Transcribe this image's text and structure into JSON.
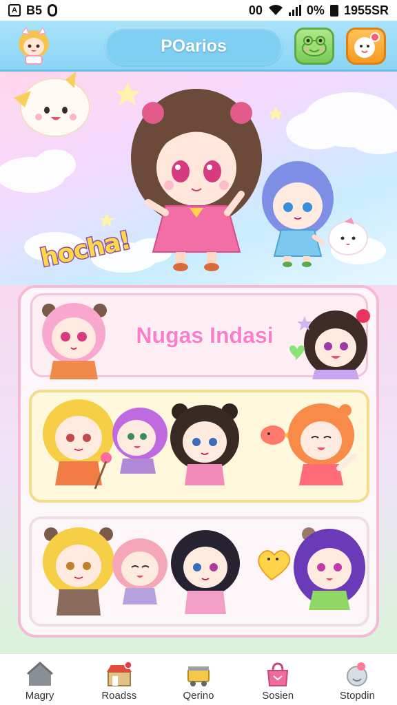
{
  "status_bar": {
    "left_badge": "A",
    "left_text": "B5",
    "right_text": "00",
    "battery_pct": "0%",
    "clock": "1955SR"
  },
  "header": {
    "title": "POarios",
    "left_icon": "character-avatar-icon",
    "green_button_icon": "frog-face-icon",
    "orange_button_icon": "chat-face-icon",
    "colors": {
      "header_bg": "#8bd5f5",
      "pill": "#7fcff3",
      "green": "#79c95a",
      "orange": "#f79a22"
    }
  },
  "hero": {
    "speech_text": "hocha!"
  },
  "cards": {
    "first_title": "Nugas Indasi"
  },
  "bottom_nav": {
    "items": [
      {
        "label": "Magry",
        "icon": "home-icon"
      },
      {
        "label": "Roadss",
        "icon": "shop-icon"
      },
      {
        "label": "Qerino",
        "icon": "gift-box-icon"
      },
      {
        "label": "Sosien",
        "icon": "bag-icon"
      },
      {
        "label": "Stopdin",
        "icon": "settings-character-icon"
      }
    ]
  }
}
